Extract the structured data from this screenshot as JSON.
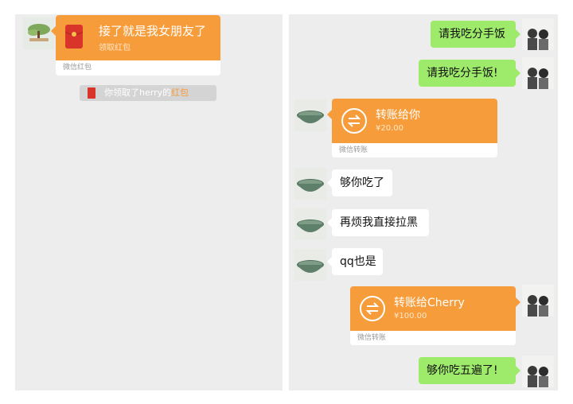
{
  "left": {
    "redpacket": {
      "title": "接了就是我女朋友了",
      "subtitle": "领取红包",
      "footer": "微信红包"
    },
    "notice": {
      "prefix": "你领取了herry的",
      "highlight": "红包",
      "highlight_color": "#f79c3a"
    }
  },
  "right": {
    "messages": [
      {
        "side": "right",
        "type": "text",
        "text": "请我吃分手饭"
      },
      {
        "side": "right",
        "type": "text",
        "text": "请我吃分手饭!"
      },
      {
        "side": "left",
        "type": "transfer",
        "title": "转账给你",
        "amount": "¥20.00",
        "footer": "微信转账"
      },
      {
        "side": "left",
        "type": "text",
        "text": "够你吃了"
      },
      {
        "side": "left",
        "type": "text",
        "text": "再烦我直接拉黑"
      },
      {
        "side": "left",
        "type": "text",
        "text": "qq也是"
      },
      {
        "side": "right",
        "type": "transfer",
        "title": "转账给Cherry",
        "amount": "¥100.00",
        "footer": "微信转账"
      },
      {
        "side": "right",
        "type": "text",
        "text": "够你吃五遍了!"
      }
    ]
  },
  "colors": {
    "panel_bg": "#ededed",
    "sent_bubble": "#9eea6a",
    "received_bubble": "#ffffff",
    "transfer_orange": "#f79c3a",
    "redpacket_red": "#d8342a"
  },
  "icons": {
    "avatar_left_panel": "bonsai-avatar",
    "avatar_contact": "bowl-avatar",
    "avatar_self": "couple-avatar",
    "transfer": "transfer-arrows-icon",
    "redpacket": "redpacket-icon"
  }
}
